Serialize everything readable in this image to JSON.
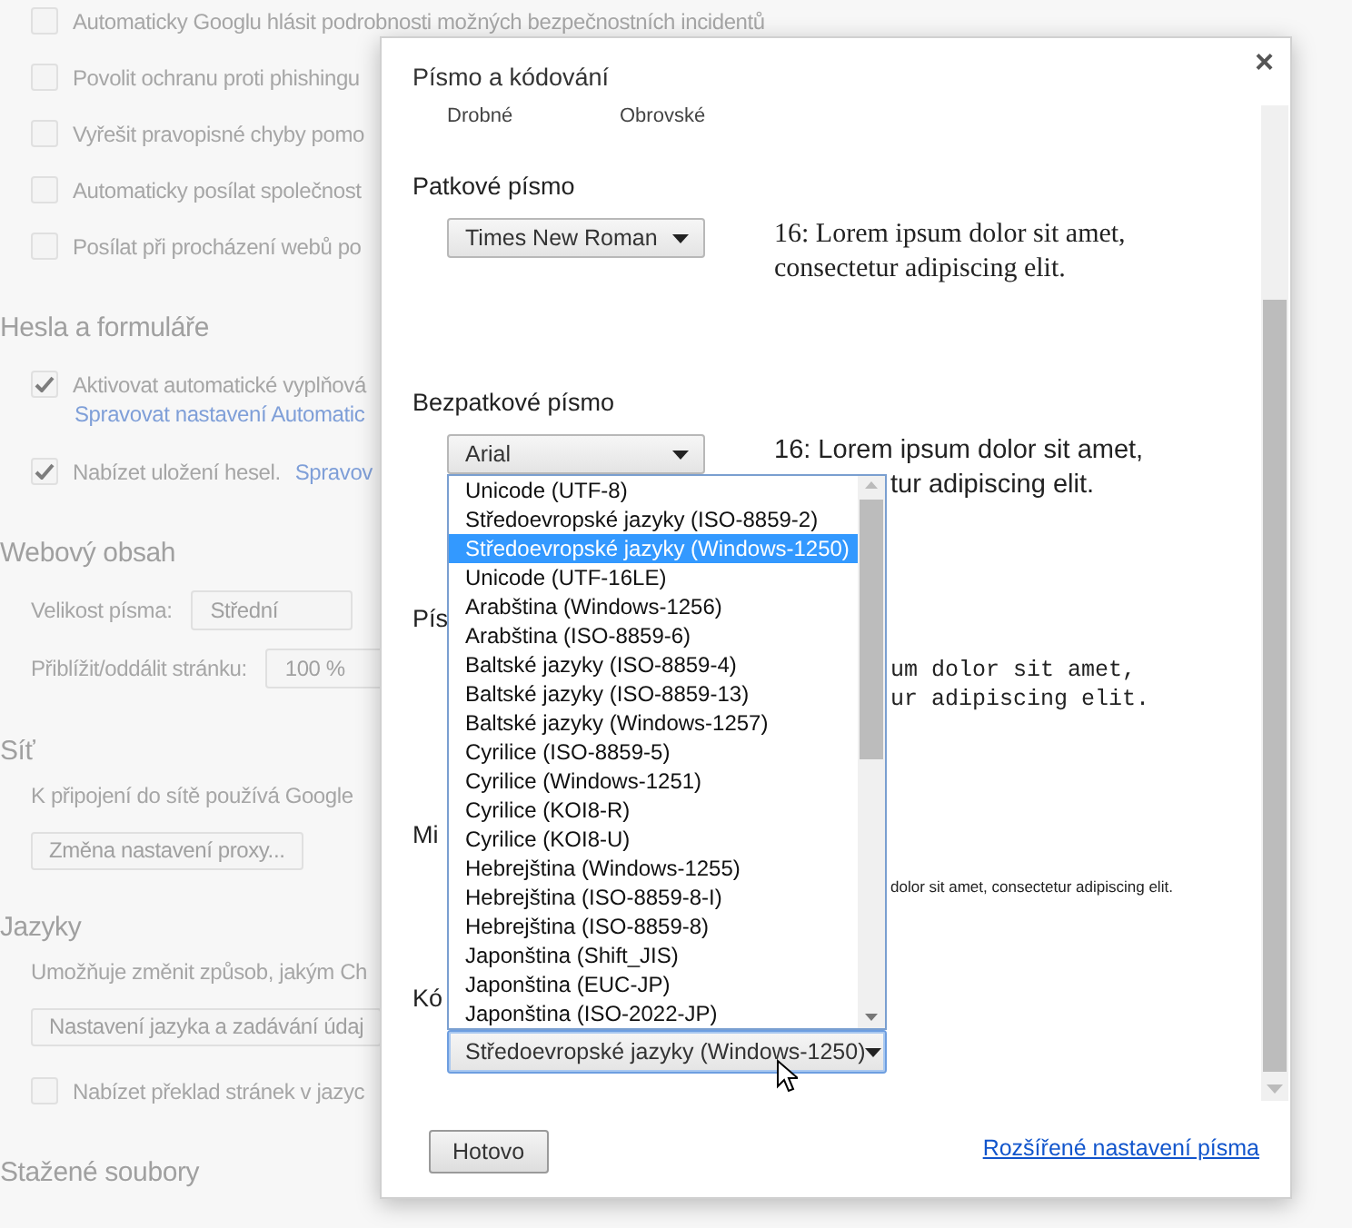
{
  "page": {
    "items": [
      {
        "kind": "checkbox",
        "label": "Automaticky Googlu hlásit podrobnosti možných bezpečnostních incidentů",
        "checked": false
      },
      {
        "kind": "checkbox",
        "label": "Povolit ochranu proti phishingu",
        "checked": false
      },
      {
        "kind": "checkbox",
        "label": "Vyřešit pravopisné chyby pomo",
        "checked": false
      },
      {
        "kind": "checkbox",
        "label": "Automaticky posílat společnost",
        "checked": false
      },
      {
        "kind": "checkbox",
        "label": "Posílat při procházení webů po",
        "checked": false
      },
      {
        "kind": "heading",
        "text": "Hesla a formuláře"
      },
      {
        "kind": "checkbox",
        "label": "Aktivovat automatické vyplňová",
        "checked": true,
        "sublink": "Spravovat nastavení Automatic"
      },
      {
        "kind": "checkbox",
        "label": "Nabízet uložení hesel.",
        "checked": true,
        "link": "Spravov"
      },
      {
        "kind": "heading",
        "text": "Webový obsah"
      },
      {
        "kind": "select_row",
        "label": "Velikost písma:",
        "value": "Střední"
      },
      {
        "kind": "select_row",
        "label": "Přiblížit/oddálit stránku:",
        "value": "100 %"
      },
      {
        "kind": "heading",
        "text": "Síť"
      },
      {
        "kind": "text",
        "text": "K připojení do sítě používá Google"
      },
      {
        "kind": "button",
        "label": "Změna nastavení proxy..."
      },
      {
        "kind": "heading",
        "text": "Jazyky"
      },
      {
        "kind": "text",
        "text": "Umožňuje změnit způsob, jakým Ch"
      },
      {
        "kind": "button",
        "label": "Nastavení jazyka a zadávání údaj"
      },
      {
        "kind": "checkbox",
        "label": "Nabízet překlad stránek v jazyc",
        "checked": false
      },
      {
        "kind": "heading",
        "text": "Stažené soubory"
      }
    ]
  },
  "dialog": {
    "title": "Písmo a kódování",
    "close": "×",
    "sections": [
      {
        "kind": "scale",
        "labels": [
          "Drobné",
          "Obrovské"
        ]
      },
      {
        "kind": "serif",
        "heading": "Patkové písmo",
        "select": "Times New Roman",
        "sample_lines": [
          {
            "text": "16: Lorem ipsum dolor sit amet,"
          },
          {
            "text": "consectetur adipiscing elit."
          }
        ]
      },
      {
        "kind": "sans",
        "heading": "Bezpatkové písmo",
        "select": "Arial",
        "sample_lines": [
          {
            "text": "16: Lorem ipsum dolor sit amet,"
          },
          {
            "text": "tur adipiscing elit.",
            "covered": true
          }
        ]
      },
      {
        "kind": "mono",
        "heading": "Pís",
        "sample_lines": [
          {
            "text": "um dolor sit amet,",
            "covered": true
          },
          {
            "text": "ur adipiscing elit.",
            "covered": true
          }
        ]
      },
      {
        "kind": "small",
        "heading": "Mi",
        "sample_lines": [
          {
            "text": "dolor sit amet, consectetur adipiscing elit.",
            "covered": true
          }
        ]
      },
      {
        "kind": "encoding",
        "heading": "Kó",
        "select": "Středoevropské jazyky (Windows-1250)",
        "focused": true,
        "options": [
          {
            "label": "Unicode (UTF-8)",
            "selected": false
          },
          {
            "label": "Středoevropské jazyky (ISO-8859-2)",
            "selected": false
          },
          {
            "label": "Středoevropské jazyky (Windows-1250)",
            "selected": true
          },
          {
            "label": "Unicode (UTF-16LE)",
            "selected": false
          },
          {
            "label": "Arabština (Windows-1256)",
            "selected": false
          },
          {
            "label": "Arabština (ISO-8859-6)",
            "selected": false
          },
          {
            "label": "Baltské jazyky (ISO-8859-4)",
            "selected": false
          },
          {
            "label": "Baltské jazyky (ISO-8859-13)",
            "selected": false
          },
          {
            "label": "Baltské jazyky (Windows-1257)",
            "selected": false
          },
          {
            "label": "Cyrilice (ISO-8859-5)",
            "selected": false
          },
          {
            "label": "Cyrilice (Windows-1251)",
            "selected": false
          },
          {
            "label": "Cyrilice (KOI8-R)",
            "selected": false
          },
          {
            "label": "Cyrilice (KOI8-U)",
            "selected": false
          },
          {
            "label": "Hebrejština (Windows-1255)",
            "selected": false
          },
          {
            "label": "Hebrejština (ISO-8859-8-I)",
            "selected": false
          },
          {
            "label": "Hebrejština (ISO-8859-8)",
            "selected": false
          },
          {
            "label": "Japonština (Shift_JIS)",
            "selected": false
          },
          {
            "label": "Japonština (EUC-JP)",
            "selected": false
          },
          {
            "label": "Japonština (ISO-2022-JP)",
            "selected": false
          }
        ]
      }
    ],
    "done_button": "Hotovo",
    "advanced_link": "Rozšířené nastavení písma"
  }
}
